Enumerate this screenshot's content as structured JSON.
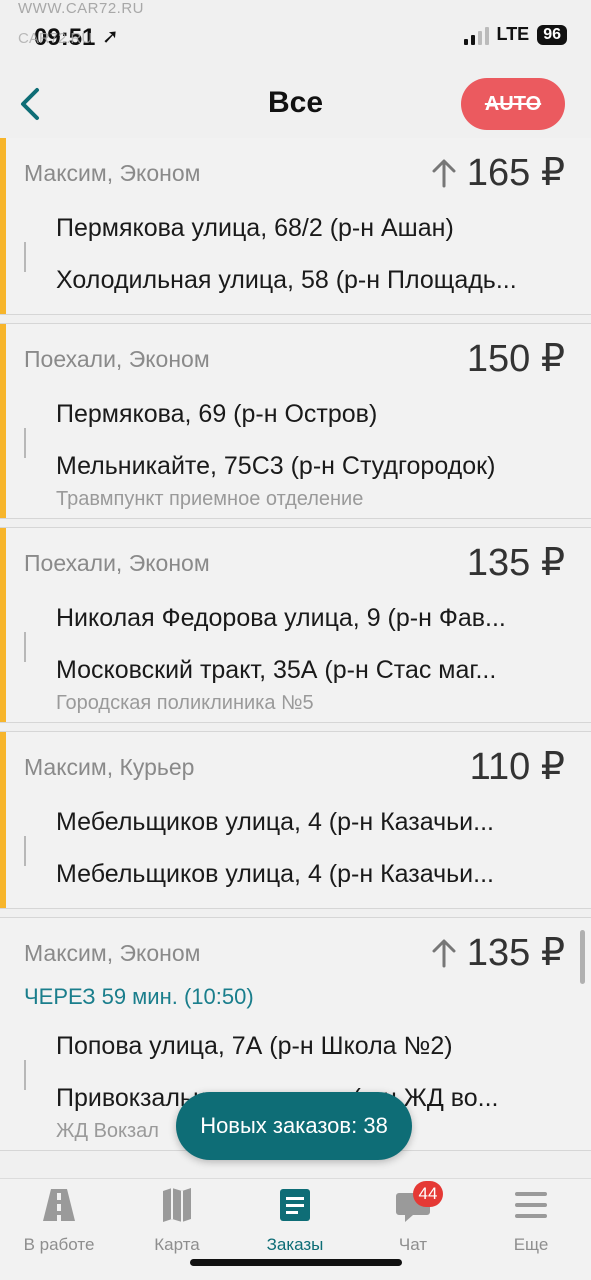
{
  "status": {
    "time": "09:51",
    "network": "LTE",
    "battery": "96",
    "watermark": "WWW.CAR72.RU",
    "watermark2": "CAR72.RU"
  },
  "header": {
    "title": "Все",
    "auto_label": "AUTO"
  },
  "orders": [
    {
      "subtitle": "Максим, Эконом",
      "price": "165 ₽",
      "surge": true,
      "scheduled": "",
      "from": "Пермякова улица, 68/2 (р-н Ашан)",
      "to": "Холодильная улица, 58 (р-н Площадь...",
      "note": ""
    },
    {
      "subtitle": "Поехали, Эконом",
      "price": "150 ₽",
      "surge": false,
      "scheduled": "",
      "from": "Пермякова, 69 (р-н Остров)",
      "to": "Мельникайте, 75С3 (р-н Студгородок)",
      "note": "Травмпункт приемное отделение"
    },
    {
      "subtitle": "Поехали, Эконом",
      "price": "135 ₽",
      "surge": false,
      "scheduled": "",
      "from": "Николая Федорова улица, 9 (р-н Фав...",
      "to": "Московский тракт, 35А (р-н Стас маг...",
      "note": "Городская поликлиника №5"
    },
    {
      "subtitle": "Максим, Курьер",
      "price": "110 ₽",
      "surge": false,
      "scheduled": "",
      "from": "Мебельщиков улица, 4 (р-н Казачьи...",
      "to": "Мебельщиков улица, 4 (р-н Казачьи...",
      "note": ""
    },
    {
      "subtitle": "Максим, Эконом",
      "price": "135 ₽",
      "surge": true,
      "scheduled": "ЧЕРЕЗ 59 мин. (10:50)",
      "from": "Попова улица, 7А (р-н Школа №2)",
      "to": "Привокзальная площадь (р-н ЖД во...",
      "note": "ЖД Вокзал"
    }
  ],
  "toast": "Новых заказов: 38",
  "nav": {
    "items": [
      {
        "label": "В работе",
        "icon": "road-icon"
      },
      {
        "label": "Карта",
        "icon": "map-icon"
      },
      {
        "label": "Заказы",
        "icon": "orders-icon"
      },
      {
        "label": "Чат",
        "icon": "chat-icon",
        "badge": "44"
      },
      {
        "label": "Еще",
        "icon": "menu-icon"
      }
    ]
  },
  "colors": {
    "accent": "#0e6d76",
    "stripe": "#f7b52b",
    "auto": "#eb5a5f",
    "badge": "#e53935"
  }
}
